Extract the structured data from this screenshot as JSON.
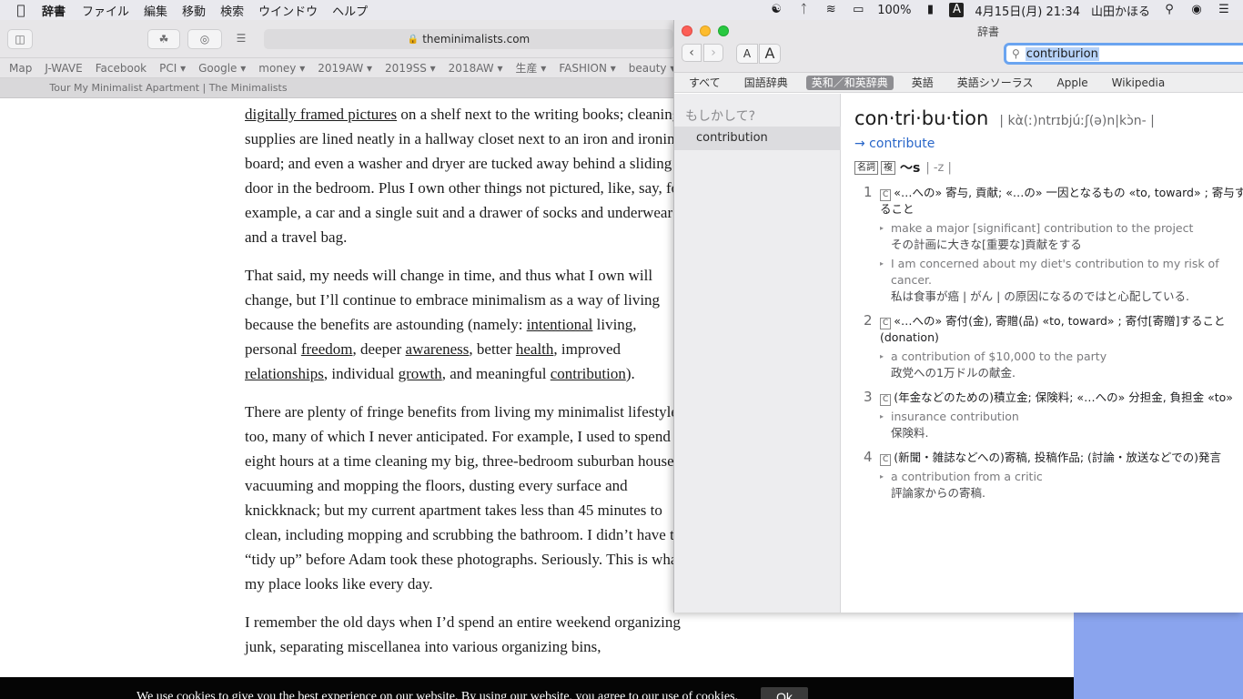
{
  "menubar": {
    "app": "辞書",
    "items": [
      "ファイル",
      "編集",
      "移動",
      "検索",
      "ウインドウ",
      "ヘルプ"
    ],
    "battery": "100%",
    "ime": "A",
    "datetime": "4月15日(月) 21:34",
    "user": "山田かほる"
  },
  "safari": {
    "url": "theminimalists.com",
    "bookmarks": [
      "Map",
      "J-WAVE",
      "Facebook",
      "PCI ▾",
      "Google ▾",
      "money ▾",
      "2019AW ▾",
      "2019SS ▾",
      "2018AW ▾",
      "生産 ▾",
      "FASHION ▾",
      "beauty ▾"
    ],
    "tab_title": "Tour My Minimalist Apartment | The Minimalists"
  },
  "article": {
    "p1": {
      "link": "digitally framed pictures",
      "text": " on a shelf next to the writing books; cleaning supplies are lined neatly in a hallway closet next to an iron and ironing board; and even a washer and dryer are tucked away behind a sliding door in the bedroom. Plus I own other things not pictured, like, say, for example, a car and a single suit and a drawer of socks and underwear and a travel bag."
    },
    "p2": {
      "t1": "That said, my needs will change in time, and thus what I own will change, but I’ll continue to embrace minimalism as a way of living because the benefits are astounding (namely: ",
      "l1": "intentional",
      "t2": " living, personal ",
      "l2": "freedom",
      "t3": ", deeper ",
      "l3": "awareness",
      "t4": ", better ",
      "l4": "health",
      "t5": ", improved ",
      "l5": "relationships",
      "t6": ", individual ",
      "l6": "growth",
      "t7": ", and meaningful ",
      "l7": "contribution",
      "t8": ")."
    },
    "p3": "There are plenty of fringe benefits from living my minimalist lifestyle, too, many of which I never anticipated. For example, I used to spend eight hours at a time cleaning my big, three-bedroom suburban house, vacuuming and mopping the floors, dusting every surface and knickknack; but my current apartment takes less than 45 minutes to clean, including mopping and scrubbing the bathroom. I didn’t have to “tidy up” before Adam took these photographs. Seriously. This is what my place looks like every day.",
    "p4": "I remember the old days when I’d spend an entire weekend organizing junk, separating miscellanea into various organizing bins,"
  },
  "cookie": {
    "message": "We use cookies to give you the best experience on our website. By using our website, you agree to our use of cookies.",
    "ok": "Ok"
  },
  "dictionary": {
    "window_title": "辞書",
    "search_value": "contriburion",
    "font_small": "A",
    "font_large": "A",
    "categories": [
      "すべて",
      "国語辞典",
      "英和／和英辞典",
      "英語",
      "英語シソーラス",
      "Apple",
      "Wikipedia"
    ],
    "active_category": "英和／和英辞典",
    "sidebar_heading": "もしかして?",
    "suggestion": "contribution",
    "headword": "con·tri·bu·tion",
    "pronunciation": "| kὰ(ː)ntrɪbjúːʃ(ə)n|kɔ̀n- |",
    "xref": "→ contribute",
    "pos_tag": "名詞",
    "count_tag": "複",
    "inflection": "〜s",
    "inflection_pron": "| -z |",
    "sense1": {
      "num": "1",
      "def": "«…への» 寄与, 貢献; «…の» 一因となるもの «to, toward» ; 寄与すること",
      "ex1": "make a major [significant] contribution to the project",
      "ex1_tr": "その計画に大きな[重要な]貢献をする",
      "ex2": "I am concerned about my diet's contribution to my risk of cancer.",
      "ex2_tr": "私は食事が癌 | がん | の原因になるのではと心配している."
    },
    "sense2": {
      "num": "2",
      "def": "«…への» 寄付(金), 寄贈(品) «to, toward» ; 寄付[寄贈]すること(donation)",
      "ex1": "a contribution of $10,000 to the party",
      "ex1_tr": "政党への1万ドルの献金."
    },
    "sense3": {
      "num": "3",
      "def": "(年金などのための)積立金; 保険料; «…への» 分担金, 負担金 «to»",
      "ex1": "insurance contribution",
      "ex1_tr": "保険料."
    },
    "sense4": {
      "num": "4",
      "def": "(新聞・雑誌などへの)寄稿, 投稿作品; (討論・放送などでの)発言",
      "ex1": "a contribution from a critic",
      "ex1_tr": "評論家からの寄稿."
    }
  }
}
